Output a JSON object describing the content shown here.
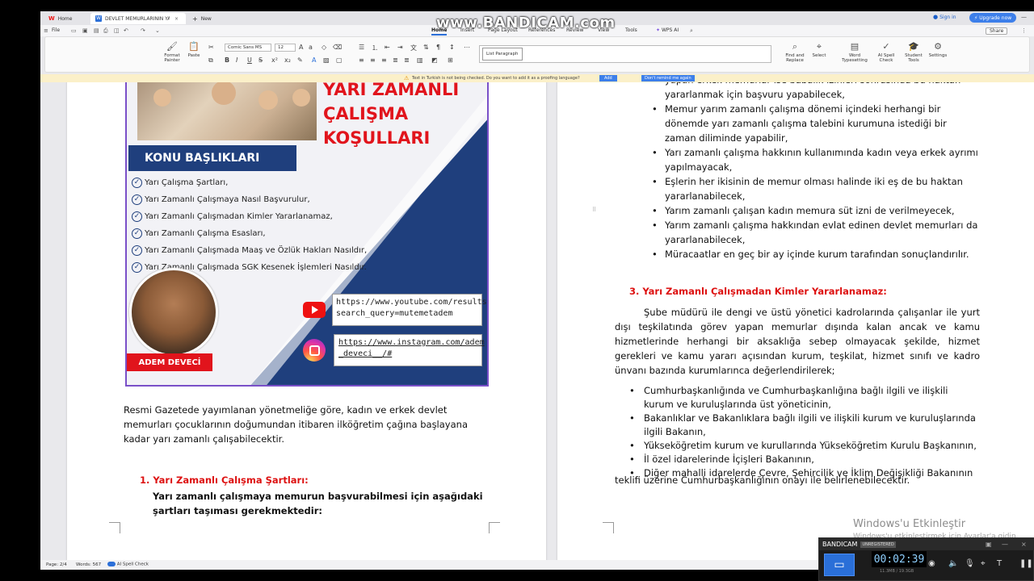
{
  "tabs": [
    {
      "label": "Home",
      "icon": "wps-logo-icon"
    },
    {
      "label": "DEVLET MEMURLARININ YAR",
      "icon": "word-doc-icon"
    },
    {
      "label": "New",
      "icon": "plus-icon"
    }
  ],
  "account": {
    "sign_in": "Sign in",
    "upgrade": "Upgrade now"
  },
  "menu": {
    "file": "File",
    "items": [
      "Home",
      "Insert",
      "Page Layout",
      "References",
      "Review",
      "View",
      "Tools",
      "WPS AI"
    ],
    "active": "Home",
    "share": "Share"
  },
  "ribbon": {
    "format_painter": "Format Painter",
    "paste": "Paste",
    "font_name": "Comic Sans MS",
    "font_size": "12",
    "style_name": "List Paragraph",
    "find_replace": "Find and Replace",
    "select": "Select",
    "word_typesetting": "Word Typesetting",
    "ai_spell_check": "AI Spell Check",
    "student_tools": "Student Tools",
    "settings": "Settings"
  },
  "notification": {
    "text": "Text in Turkish is not being checked. Do you want to add it as a proofing language?",
    "add": "Add",
    "dont_remind": "Don't remind me again"
  },
  "poster": {
    "title_lines": [
      "YARI ZAMANLI",
      "ÇALIŞMA",
      "KOŞULLARI"
    ],
    "konu_title": "KONU BAŞLIKLARI",
    "konu_items": [
      "Yarı Çalışma Şartları,",
      "Yarı Zamanlı Çalışmaya Nasıl Başvurulur,",
      "Yarı Zamanlı Çalışmadan Kimler Yararlanamaz,",
      "Yarı Zamanlı Çalışma Esasları,",
      "Yarı Zamanlı Çalışmada Maaş ve Özlük Hakları Nasıldır,",
      "Yarı Zamanlı Çalışmada SGK Kesenek İşlemleri Nasıldır."
    ],
    "name": "ADEM DEVECİ",
    "youtube_link": [
      "https://www.youtube.com/results?",
      "search_query=mutemetadem"
    ],
    "instagram_link": [
      "https://www.instagram.com/adem",
      "_deveci__/#"
    ]
  },
  "left_page": {
    "paragraph": "Resmi Gazetede yayımlanan yönetmeliğe göre, kadın ve erkek devlet memurları çocuklarının doğumundan itibaren ilköğretim çağına başlayana kadar yarı zamanlı çalışabilecektir.",
    "section1_title": "1. Yarı Zamanlı Çalışma Şartları:",
    "section1_text": "Yarı zamanlı çalışmaya memurun başvurabilmesi için aşağıdaki şartları taşıması gerekmektedir:"
  },
  "right_page": {
    "bullets": [
      {
        "text": "yapan erkek memurlar ise babalık izinleri sonrasında bu haktan yararlanmak için başvuru yapabilecek,",
        "bullet": false
      },
      {
        "text": "Memur yarım zamanlı çalışma dönemi içindeki herhangi bir dönemde yarı zamanlı çalışma talebini kurumuna istediği bir zaman diliminde yapabilir,",
        "bullet": true
      },
      {
        "text": "Yarı zamanlı çalışma hakkının kullanımında kadın veya erkek ayrımı yapılmayacak,",
        "bullet": true
      },
      {
        "text": "Eşlerin her ikisinin de memur olması halinde iki eş de bu haktan yararlanabilecek,",
        "bullet": true
      },
      {
        "text": "Yarım zamanlı çalışan kadın memura süt izni de verilmeyecek,",
        "bullet": true
      },
      {
        "text": "Yarım zamanlı çalışma hakkından evlat edinen devlet memurları da yararlanabilecek,",
        "bullet": true
      },
      {
        "text": "Müracaatlar en geç bir ay içinde kurum tarafından sonuçlandırılır.",
        "bullet": true
      }
    ],
    "section3_title": "3. Yarı Zamanlı Çalışmadan Kimler Yararlanamaz:",
    "section3_para": "Şube müdürü ile dengi ve üstü yönetici kadrolarında çalışanlar ile yurt dışı teşkilatında görev yapan memurlar dışında kalan ancak ve kamu hizmetlerinde herhangi bir aksaklığa sebep olmayacak şekilde, hizmet gerekleri ve kamu yararı açısından kurum, teşkilat, hizmet sınıfı ve kadro ünvanı bazında kurumlarınca değerlendirilerek;",
    "bullets2": [
      "Cumhurbaşkanlığında ve Cumhurbaşkanlığına bağlı ilgili ve ilişkili kurum ve kuruluşlarında üst yöneticinin,",
      "Bakanlıklar ve Bakanlıklara bağlı ilgili ve ilişkili kurum ve  kuruluşlarında ilgili Bakanın,",
      "Yükseköğretim kurum ve kurullarında Yükseköğretim Kurulu Başkanının,",
      "İl özel idarelerinde İçişleri Bakanının,",
      "Diğer mahalli idarelerde Çevre, Şehircilik ve İklim Değişikliği Bakanının"
    ],
    "tail": "teklifi üzerine Cumhurbaşkanlığının onayı ile belirlenebilecektir."
  },
  "status": {
    "page": "Page: 2/4",
    "words": "Words: 567",
    "spell": "AI Spell Check"
  },
  "overlay": {
    "watermark": "www.BANDICAM.com",
    "activate_title": "Windows'u Etkinleştir",
    "activate_sub": "Windows'u etkinleştirmek için Ayarlar'a gidin.",
    "bandicam_brand": "BANDICAM",
    "bandicam_unreg": "UNREGISTERED",
    "timer": "00:02:39",
    "size": "11.3MB / 19.3GB"
  }
}
